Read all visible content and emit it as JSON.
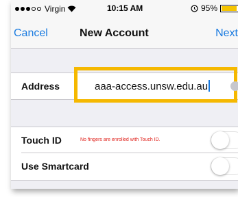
{
  "status_bar": {
    "carrier": "Virgin",
    "time": "10:15 AM",
    "battery_percent": "95%",
    "battery_level": 0.95
  },
  "nav": {
    "cancel_label": "Cancel",
    "title": "New Account",
    "next_label": "Next"
  },
  "address": {
    "label": "Address",
    "value": "aaa-access.unsw.edu.au",
    "highlight_color": "#f5b800"
  },
  "settings": {
    "touch_id": {
      "label": "Touch ID",
      "note": "No fingers are enrolled with Touch ID.",
      "enabled": false
    },
    "smartcard": {
      "label": "Use Smartcard",
      "enabled": false
    }
  },
  "colors": {
    "accent": "#1a7be0",
    "warning_text": "#e0201a",
    "background": "#efeff4"
  }
}
